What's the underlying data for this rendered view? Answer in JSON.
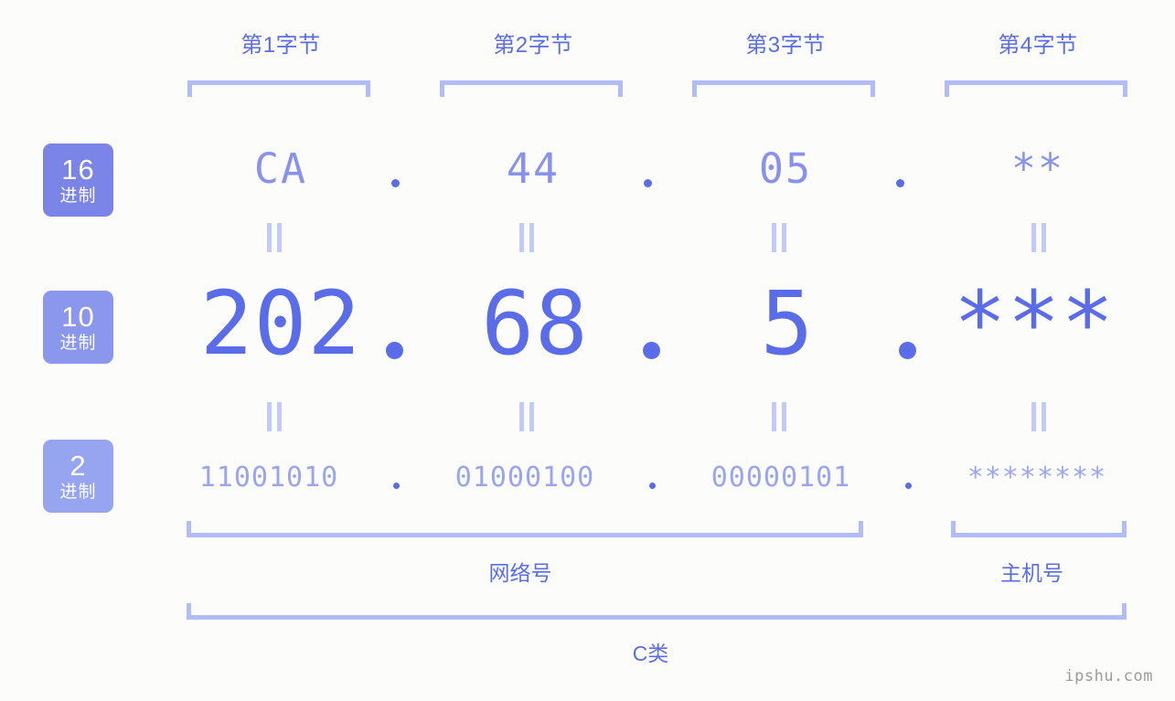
{
  "meta": {
    "watermark": "ipshu.com",
    "background_color": "#fcfdfa",
    "accent_color": "#5b6ce8",
    "bracket_color": "#b3bcfb"
  },
  "byte_headers": [
    {
      "label": "第1字节"
    },
    {
      "label": "第2字节"
    },
    {
      "label": "第3字节"
    },
    {
      "label": "第4字节"
    }
  ],
  "radix_badges": [
    {
      "number": "16",
      "suffix": "进制",
      "color": "#7b85e8"
    },
    {
      "number": "10",
      "suffix": "进制",
      "color": "#8b97ec"
    },
    {
      "number": "2",
      "suffix": "进制",
      "color": "#97a5f0"
    }
  ],
  "rows": {
    "hex": {
      "radix": "16",
      "values": [
        "CA",
        "44",
        "05",
        "**"
      ],
      "separator": "."
    },
    "decimal": {
      "radix": "10",
      "values": [
        "202",
        "68",
        "5",
        "***"
      ],
      "separator": "."
    },
    "binary": {
      "radix": "2",
      "values": [
        "11001010",
        "01000100",
        "00000101",
        "********"
      ],
      "separator": "."
    }
  },
  "equals_marks": {
    "symbol": "=",
    "count_per_row": 4
  },
  "sections": [
    {
      "label": "网络号"
    },
    {
      "label": "主机号"
    }
  ],
  "ip_class": {
    "label": "C类"
  }
}
